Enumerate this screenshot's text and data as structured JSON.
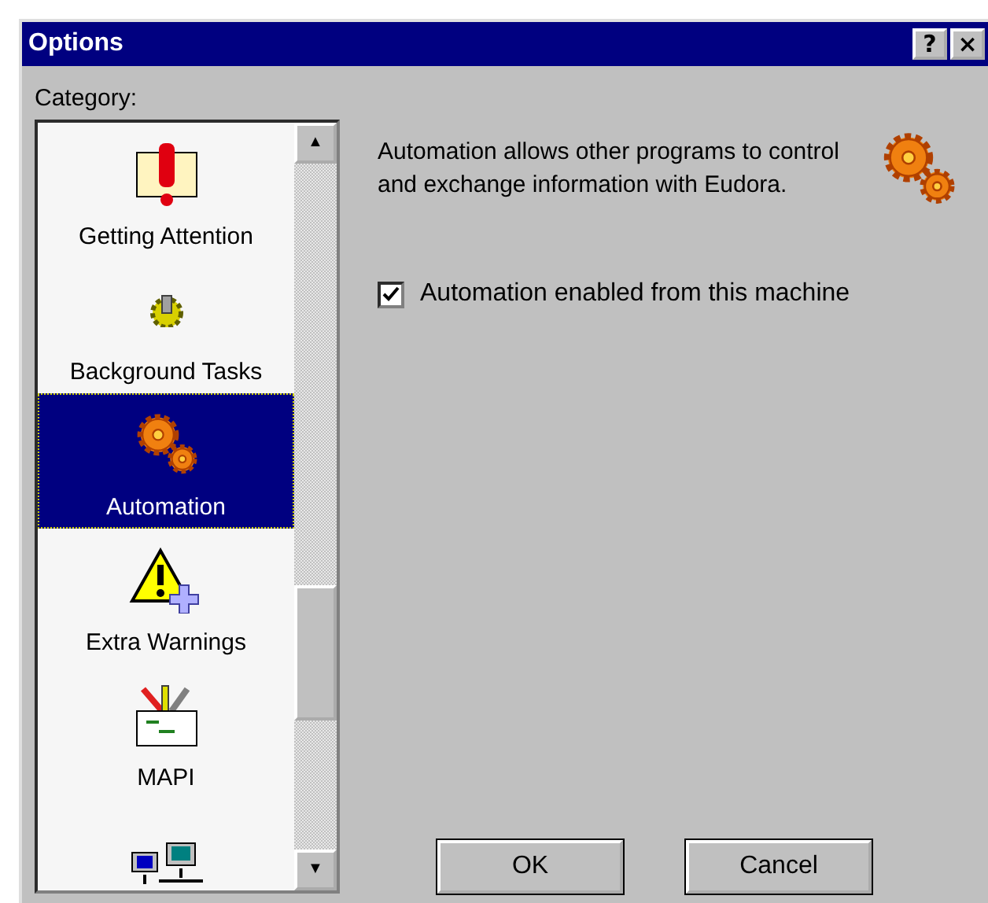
{
  "window": {
    "title": "Options",
    "title_buttons": [
      "?",
      "×"
    ]
  },
  "category_label": "Category:",
  "categories": [
    {
      "label": "Getting Attention",
      "selected": false
    },
    {
      "label": "Background Tasks",
      "selected": false
    },
    {
      "label": "Automation",
      "selected": true
    },
    {
      "label": "Extra Warnings",
      "selected": false
    },
    {
      "label": "MAPI",
      "selected": false
    },
    {
      "selected": false
    }
  ],
  "scrollbar": {
    "up": "▲",
    "down": "▼"
  },
  "description": "Automation allows other programs to control and exchange information with Eudora.",
  "checkbox": {
    "label": "Automation enabled from this machine",
    "checked": true
  },
  "buttons": [
    "OK",
    "Cancel"
  ]
}
